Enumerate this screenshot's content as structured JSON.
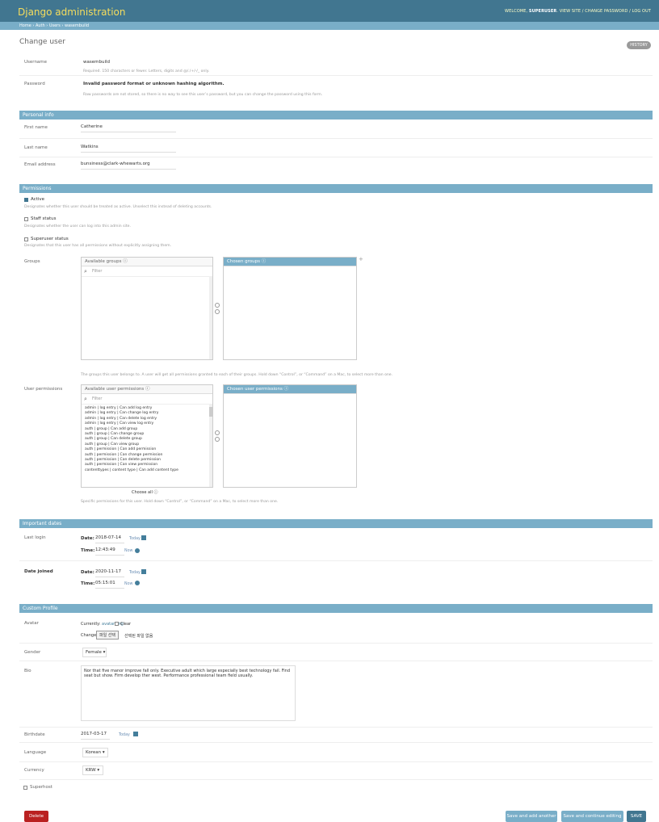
{
  "header": {
    "brand": "Django administration",
    "welcome": "WELCOME, ",
    "username": "SUPERUSER",
    "view_site": "VIEW SITE",
    "change_password": "CHANGE PASSWORD",
    "logout": "LOG OUT"
  },
  "breadcrumbs": "Home › Auth › Users › wasembuild",
  "page": {
    "title": "Change user",
    "history": "HISTORY"
  },
  "user": {
    "username_label": "Username",
    "username_value": "wasembuild",
    "username_help": "Required. 150 characters or fewer. Letters, digits and @/./+/-/_ only.",
    "password_label": "Password",
    "password_value": "Invalid password format or unknown hashing algorithm.",
    "password_help": "Raw passwords are not stored, so there is no way to see this user’s password, but you can change the password using this form."
  },
  "personal_info": {
    "section": "Personal info",
    "first_name_label": "First name",
    "first_name_value": "Catherine",
    "last_name_label": "Last name",
    "last_name_value": "Watkins",
    "email_label": "Email address",
    "email_value": "bunsiness@clark-whewarts.org"
  },
  "permissions": {
    "section": "Permissions",
    "active_label": "Active",
    "active_help": "Designates whether this user should be treated as active. Unselect this instead of deleting accounts.",
    "staff_label": "Staff status",
    "staff_help": "Designates whether the user can log into this admin site.",
    "superuser_label": "Superuser status",
    "superuser_help": "Designates that this user has all permissions without explicitly assigning them.",
    "groups_label": "Groups",
    "available_groups": "Available groups",
    "chosen_groups": "Chosen groups",
    "filter_placeholder": "Filter",
    "groups_help": "The groups this user belongs to. A user will get all permissions granted to each of their groups. Hold down “Control”, or “Command” on a Mac, to select more than one.",
    "user_perms_label": "User permissions",
    "available_perms": "Available user permissions",
    "chosen_perms": "Chosen user permissions",
    "choose_all": "Choose all",
    "perms_help": "Specific permissions for this user. Hold down “Control”, or “Command” on a Mac, to select more than one.",
    "perm_items": [
      "admin | log entry | Can add log entry",
      "admin | log entry | Can change log entry",
      "admin | log entry | Can delete log entry",
      "admin | log entry | Can view log entry",
      "auth | group | Can add group",
      "auth | group | Can change group",
      "auth | group | Can delete group",
      "auth | group | Can view group",
      "auth | permission | Can add permission",
      "auth | permission | Can change permission",
      "auth | permission | Can delete permission",
      "auth | permission | Can view permission",
      "contenttypes | content type | Can add content type"
    ]
  },
  "important_dates": {
    "section": "Important dates",
    "last_login_label": "Last login",
    "date_label": "Date:",
    "time_label": "Time:",
    "last_login_date": "2018-07-14",
    "last_login_time": "12:43:49",
    "date_joined_label": "Date joined",
    "date_joined_date": "2020-11-17",
    "date_joined_time": "05:15:01",
    "today": "Today",
    "now": "Now"
  },
  "profile": {
    "section": "Custom Profile",
    "avatar_label": "Avatar",
    "currently": "Currently: ",
    "avatar_file": "avatar.png",
    "clear": "Clear",
    "change": "Change: ",
    "choose_file": "파일 선택",
    "no_file": "선택된 파일 없음",
    "gender_label": "Gender",
    "gender_value": "Female",
    "bio_label": "Bio",
    "bio_text": "Nor that five manor improve fall only. Executive adult which large especially best technology fail. Find seat but show. Firm develop ther west. Performance professional team field usually.",
    "birthdate_label": "Birthdate",
    "birthdate_value": "2017-03-17",
    "language_label": "Language",
    "language_value": "Korean",
    "currency_label": "Currency",
    "currency_value": "KRW",
    "superhost_label": "Superhost"
  },
  "footer": {
    "delete": "Delete",
    "save_add": "Save and add another",
    "save_continue": "Save and continue editing",
    "save": "SAVE"
  },
  "colors": {
    "header_bg": "#417690",
    "section_bg": "#79aec8",
    "delete_bg": "#ba2121",
    "save_bg": "#417690",
    "secondary_bg": "#79aec8"
  }
}
